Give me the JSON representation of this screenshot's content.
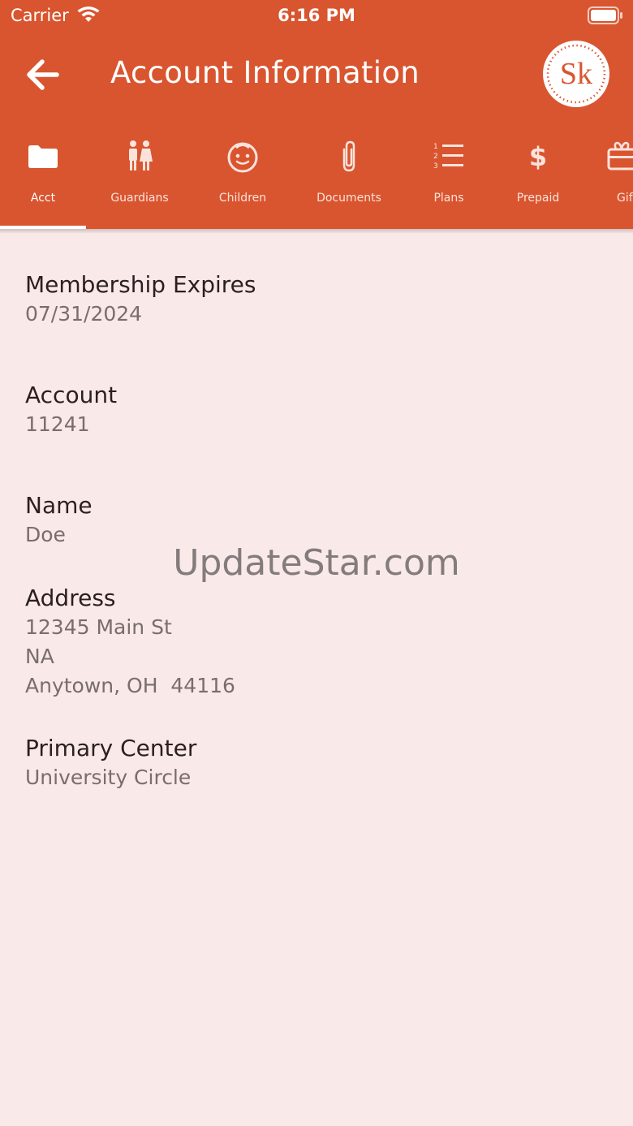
{
  "status_bar": {
    "carrier": "Carrier",
    "time": "6:16 PM"
  },
  "header": {
    "title": "Account Information",
    "logo_text": "Sk"
  },
  "tabs": [
    {
      "label": "Acct",
      "icon": "folder-icon",
      "active": true
    },
    {
      "label": "Guardians",
      "icon": "guardians-icon"
    },
    {
      "label": "Children",
      "icon": "child-face-icon"
    },
    {
      "label": "Documents",
      "icon": "paperclip-icon"
    },
    {
      "label": "Plans",
      "icon": "numbered-list-icon"
    },
    {
      "label": "Prepaid",
      "icon": "dollar-icon"
    },
    {
      "label": "Gif",
      "icon": "gift-card-icon"
    }
  ],
  "fields": {
    "membership": {
      "label": "Membership Expires",
      "value": "07/31/2024"
    },
    "account": {
      "label": "Account",
      "value": "11241"
    },
    "name": {
      "label": "Name",
      "value": "Doe"
    },
    "address": {
      "label": "Address",
      "line1": "12345 Main St",
      "line2": "NA",
      "line3": "Anytown, OH  44116"
    },
    "primary_center": {
      "label": "Primary Center",
      "value": "University Circle"
    }
  },
  "watermark": "UpdateStar.com",
  "colors": {
    "brand": "#d9552f",
    "background": "#fae9e9"
  }
}
